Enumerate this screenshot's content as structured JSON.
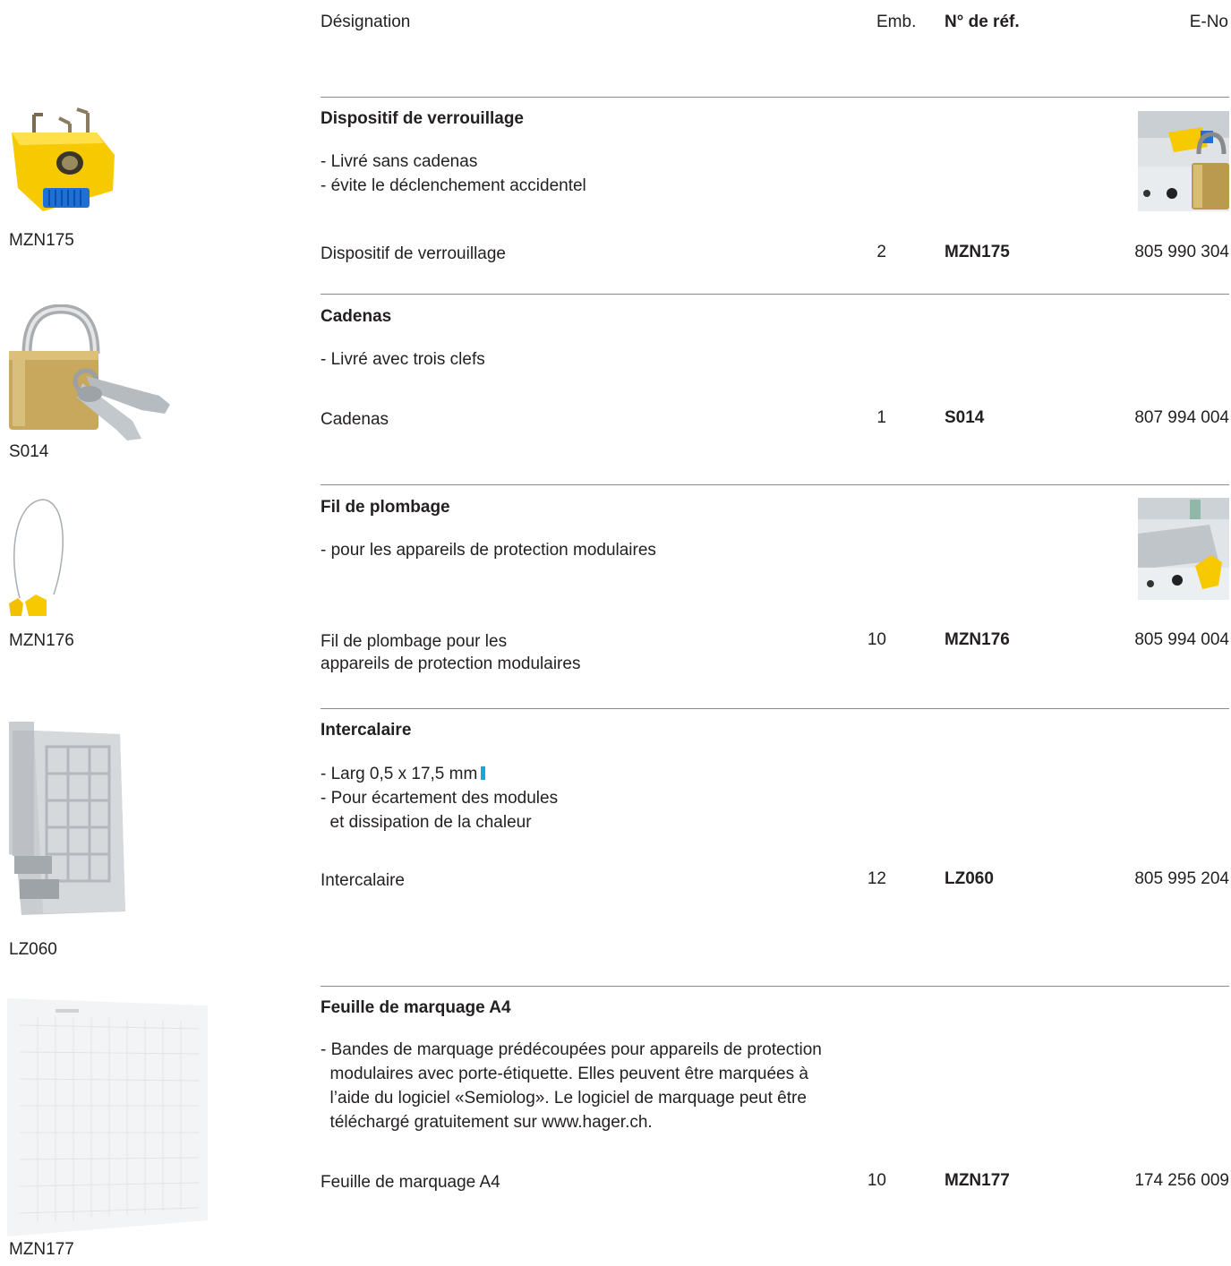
{
  "header": {
    "designation": "Désignation",
    "emb": "Emb.",
    "ref": "N° de réf.",
    "eno": "E-No"
  },
  "sections": [
    {
      "title": "Dispositif de verrouillage",
      "bullets": [
        "- Livré sans cadenas",
        "- évite le déclenchement accidentel"
      ],
      "row": {
        "designation": "Dispositif de verrouillage",
        "emb": "2",
        "ref": "MZN175",
        "eno": "805 990 304"
      },
      "caption": "MZN175",
      "thumb_icon": "locking-device-icon"
    },
    {
      "title": "Cadenas",
      "bullets": [
        "- Livré avec trois clefs"
      ],
      "row": {
        "designation": "Cadenas",
        "emb": "1",
        "ref": "S014",
        "eno": "807 994 004"
      },
      "caption": "S014",
      "thumb_icon": "padlock-icon"
    },
    {
      "title": "Fil de plombage",
      "bullets": [
        "- pour les appareils de protection modulaires"
      ],
      "row": {
        "designation": "Fil de plombage pour les\nappareils de protection modulaires",
        "emb": "10",
        "ref": "MZN176",
        "eno": "805 994 004"
      },
      "caption": "MZN176",
      "thumb_icon": "seal-wire-icon"
    },
    {
      "title": "Intercalaire",
      "bullets": [
        "- Larg 0,5 x 17,5 mm",
        "- Pour écartement des modules",
        "  et dissipation de la chaleur"
      ],
      "row": {
        "designation": "Intercalaire",
        "emb": "12",
        "ref": "LZ060",
        "eno": "805 995 204"
      },
      "caption": "LZ060",
      "thumb_icon": "spacer-icon"
    },
    {
      "title": "Feuille de marquage A4",
      "bullets": [
        "- Bandes de marquage prédécoupées pour appareils de protection",
        "  modulaires avec porte-étiquette. Elles peuvent être marquées à",
        "  l’aide du logiciel «Semiolog». Le logiciel de marquage peut être",
        "  téléchargé gratuitement sur www.hager.ch."
      ],
      "row": {
        "designation": "Feuille de marquage A4",
        "emb": "10",
        "ref": "MZN177",
        "eno": "174 256 009"
      },
      "caption": "MZN177",
      "thumb_icon": "marking-sheet-icon"
    }
  ],
  "colors": {
    "text": "#231f20",
    "rule": "#8a8a8a",
    "accent_cyan": "#19a6e0",
    "yellow": "#f5c400",
    "blue": "#1f6fd0"
  }
}
